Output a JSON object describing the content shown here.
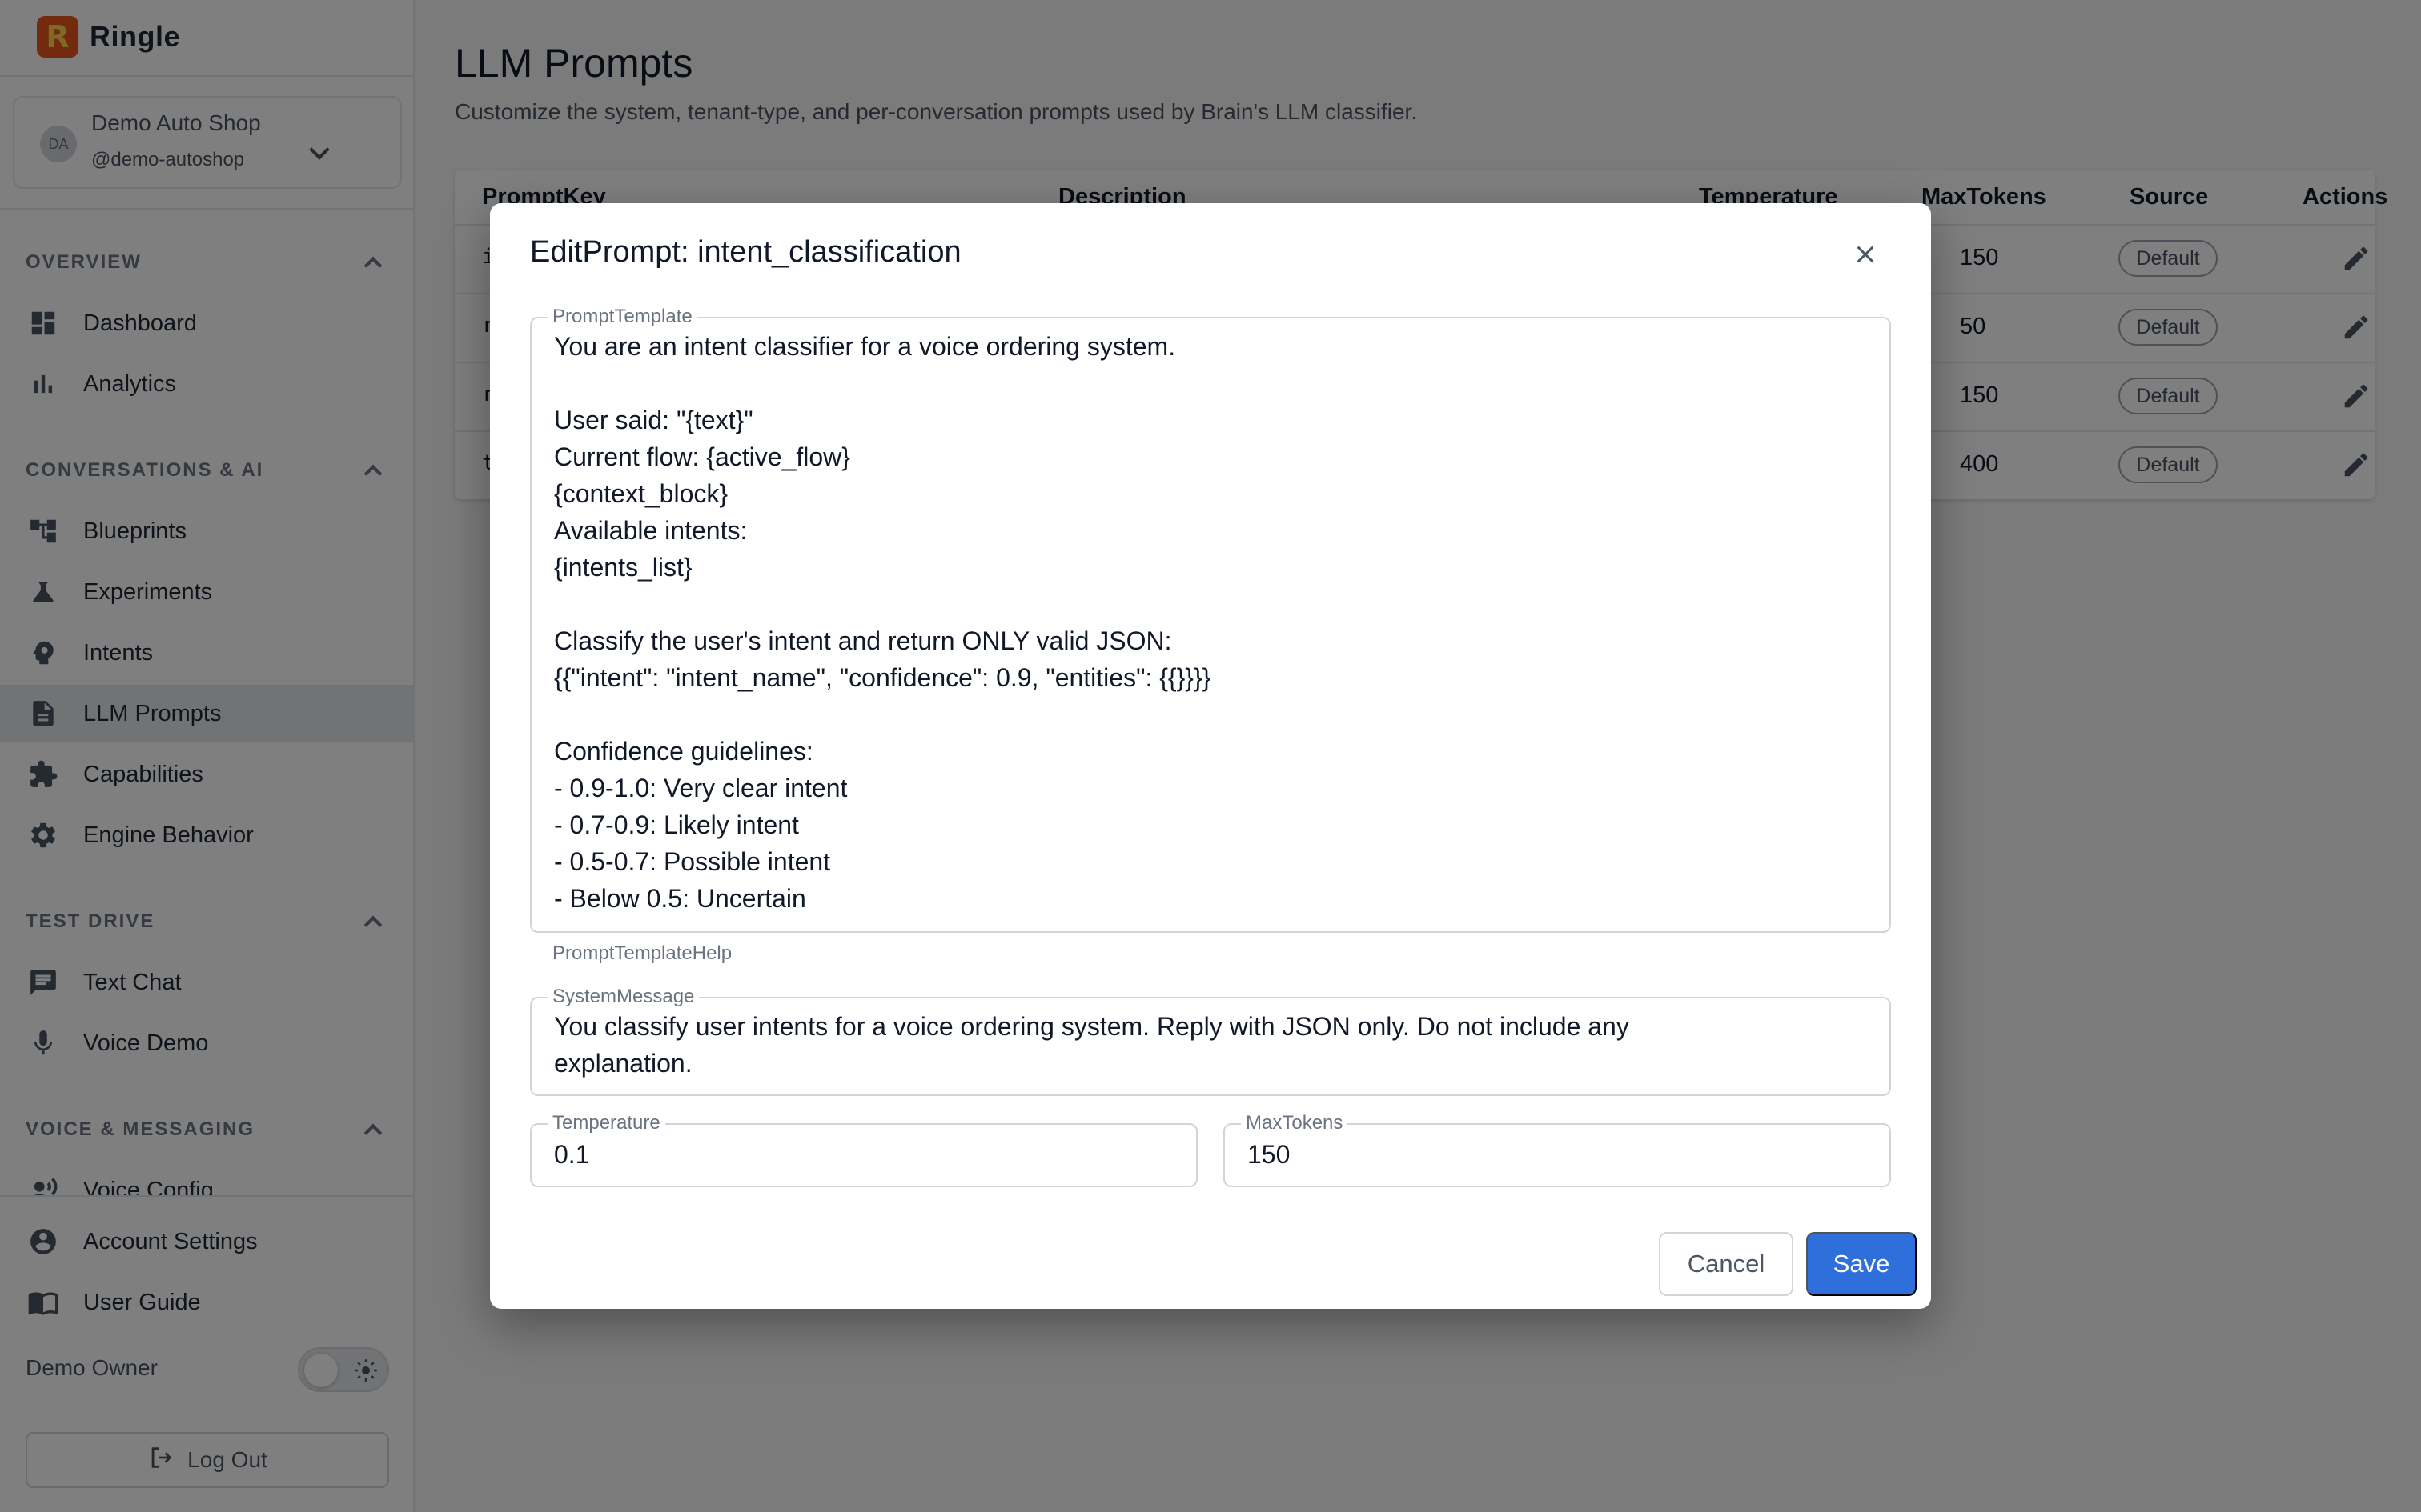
{
  "brand": {
    "logo_letter": "R",
    "name": "Ringle"
  },
  "account": {
    "initials": "DA",
    "name": "Demo Auto Shop",
    "handle": "@demo-autoshop"
  },
  "sidebar": {
    "sections": [
      {
        "title": "OVERVIEW"
      },
      {
        "title": "CONVERSATIONS & AI"
      },
      {
        "title": "TEST DRIVE"
      },
      {
        "title": "VOICE & MESSAGING"
      }
    ],
    "items": {
      "dashboard": "Dashboard",
      "analytics": "Analytics",
      "blueprints": "Blueprints",
      "experiments": "Experiments",
      "intents": "Intents",
      "llm_prompts": "LLM Prompts",
      "capabilities": "Capabilities",
      "engine_behavior": "Engine Behavior",
      "text_chat": "Text Chat",
      "voice_demo": "Voice Demo",
      "voice_config": "Voice Config"
    },
    "bottom": {
      "account_settings": "Account Settings",
      "user_guide": "User Guide",
      "demo_owner": "Demo Owner",
      "logout": "Log Out"
    }
  },
  "main": {
    "title": "LLM Prompts",
    "subtitle": "Customize the system, tenant-type, and per-conversation prompts used by Brain's LLM classifier.",
    "table": {
      "headers": {
        "prompt_key": "PromptKey",
        "description": "Description",
        "temperature": "Temperature",
        "max_tokens": "MaxTokens",
        "source": "Source",
        "actions": "Actions"
      },
      "rows": [
        {
          "key": "i",
          "max_tokens": "150",
          "source": "Default"
        },
        {
          "key": "r",
          "max_tokens": "50",
          "source": "Default"
        },
        {
          "key": "r",
          "max_tokens": "150",
          "source": "Default"
        },
        {
          "key": "t",
          "max_tokens": "400",
          "source": "Default"
        }
      ]
    }
  },
  "dialog": {
    "title": "EditPrompt: intent_classification",
    "prompt_template_label": "PromptTemplate",
    "prompt_template_value": "You are an intent classifier for a voice ordering system.\n\nUser said: \"{text}\"\nCurrent flow: {active_flow}\n{context_block}\nAvailable intents:\n{intents_list}\n\nClassify the user's intent and return ONLY valid JSON:\n{{\"intent\": \"intent_name\", \"confidence\": 0.9, \"entities\": {{}}}}\n\nConfidence guidelines:\n- 0.9-1.0: Very clear intent\n- 0.7-0.9: Likely intent\n- 0.5-0.7: Possible intent\n- Below 0.5: Uncertain",
    "prompt_template_help": "PromptTemplateHelp",
    "system_message_label": "SystemMessage",
    "system_message_value": "You classify user intents for a voice ordering system. Reply with JSON only. Do not include any\nexplanation.",
    "temperature_label": "Temperature",
    "temperature_value": "0.1",
    "max_tokens_label": "MaxTokens",
    "max_tokens_value": "150",
    "cancel_label": "Cancel",
    "save_label": "Save"
  },
  "colors": {
    "accent": "#2f6fdb",
    "brand": "#e8541e",
    "overlay": "rgba(0,0,0,0.5)"
  }
}
